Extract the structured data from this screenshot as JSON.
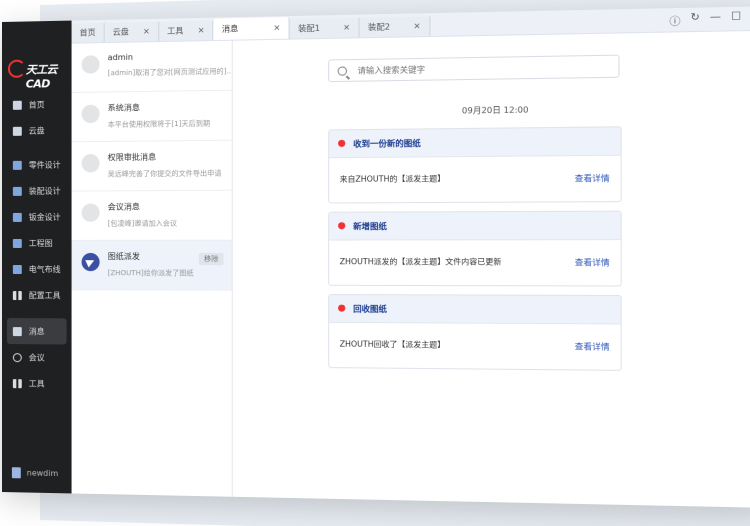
{
  "sidebar": {
    "logo": "天工云CAD",
    "items": [
      {
        "label": "首页",
        "icon": "home-icon"
      },
      {
        "label": "云盘",
        "icon": "cloud-drive-icon"
      },
      {
        "label": "零件设计",
        "icon": "part-design-icon"
      },
      {
        "label": "装配设计",
        "icon": "assembly-design-icon"
      },
      {
        "label": "钣金设计",
        "icon": "sheet-metal-icon"
      },
      {
        "label": "工程图",
        "icon": "drawing-icon"
      },
      {
        "label": "电气布线",
        "icon": "electrical-icon"
      },
      {
        "label": "配置工具",
        "icon": "config-tool-icon"
      },
      {
        "label": "消息",
        "icon": "message-icon"
      },
      {
        "label": "会议",
        "icon": "meeting-icon"
      },
      {
        "label": "工具",
        "icon": "tools-icon"
      }
    ],
    "user": "newdim"
  },
  "tabs": [
    {
      "label": "首页",
      "closable": false
    },
    {
      "label": "云盘",
      "closable": true
    },
    {
      "label": "工具",
      "closable": true
    },
    {
      "label": "消息",
      "closable": true,
      "active": true
    },
    {
      "label": "装配1",
      "closable": true
    },
    {
      "label": "装配2",
      "closable": true
    }
  ],
  "messages": [
    {
      "title": "admin",
      "preview": "[admin]取消了您对[网页测试应用的]..."
    },
    {
      "title": "系统消息",
      "preview": "本平台使用权限将于[1]天后到期"
    },
    {
      "title": "权限审批消息",
      "preview": "吴远峰完善了你提交的文件导出申请"
    },
    {
      "title": "会议消息",
      "preview": "[包凌峰]邀请加入会议"
    },
    {
      "title": "图纸派发",
      "preview": "[ZHOUTH]给你派发了图纸",
      "action": "移除"
    }
  ],
  "search": {
    "placeholder": "请输入搜索关键字"
  },
  "timestamp": "09月20日  12:00",
  "cards": [
    {
      "title": "收到一份新的图纸",
      "body": "来自ZHOUTH的【派发主题】",
      "link": "查看详情"
    },
    {
      "title": "新增图纸",
      "body": "ZHOUTH派发的【派发主题】文件内容已更新",
      "link": "查看详情"
    },
    {
      "title": "回收图纸",
      "body": "ZHOUTH回收了【派发主题】",
      "link": "查看详情"
    }
  ],
  "colors": {
    "sidebar": "#1f2022",
    "accent": "#2d56b8",
    "dot": "#e33333"
  }
}
